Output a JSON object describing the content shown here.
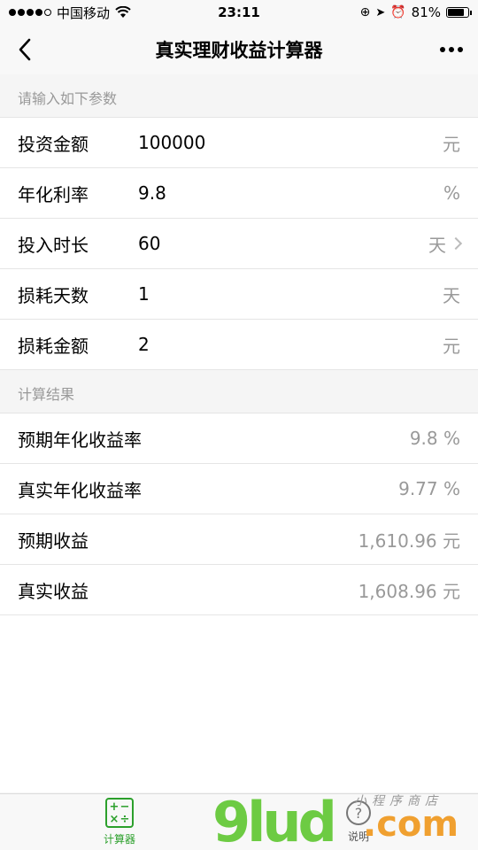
{
  "status_bar": {
    "carrier": "中国移动",
    "time": "23:11",
    "battery": "81%",
    "battery_level": 0.81,
    "signal_dots_filled": 4,
    "signal_dots_total": 5
  },
  "nav": {
    "title": "真实理财收益计算器",
    "back_icon": "chevron-left-icon",
    "more_icon": "more-dots-icon"
  },
  "inputs_section": {
    "header": "请输入如下参数",
    "rows": [
      {
        "label": "投资金额",
        "value": "100000",
        "unit": "元"
      },
      {
        "label": "年化利率",
        "value": "9.8",
        "unit": "%"
      },
      {
        "label": "投入时长",
        "value": "60",
        "unit": "天",
        "has_chevron": true
      },
      {
        "label": "损耗天数",
        "value": "1",
        "unit": "天"
      },
      {
        "label": "损耗金额",
        "value": "2",
        "unit": "元"
      }
    ]
  },
  "results_section": {
    "header": "计算结果",
    "rows": [
      {
        "label": "预期年化收益率",
        "value": "9.8 %"
      },
      {
        "label": "真实年化收益率",
        "value": "9.77 %"
      },
      {
        "label": "预期收益",
        "value": "1,610.96 元"
      },
      {
        "label": "真实收益",
        "value": "1,608.96 元"
      }
    ]
  },
  "tab_bar": {
    "tabs": [
      {
        "label": "计算器",
        "icon": "calculator-icon",
        "active": true
      },
      {
        "label": "说明",
        "icon": "info-icon",
        "active": false
      }
    ]
  },
  "watermark": {
    "text_main": "9lud",
    "text_com": ".com",
    "text_sub": "小程序商店"
  },
  "colors": {
    "accent": "#2ca02c",
    "muted_text": "#999999",
    "divider": "#e5e5e5"
  }
}
